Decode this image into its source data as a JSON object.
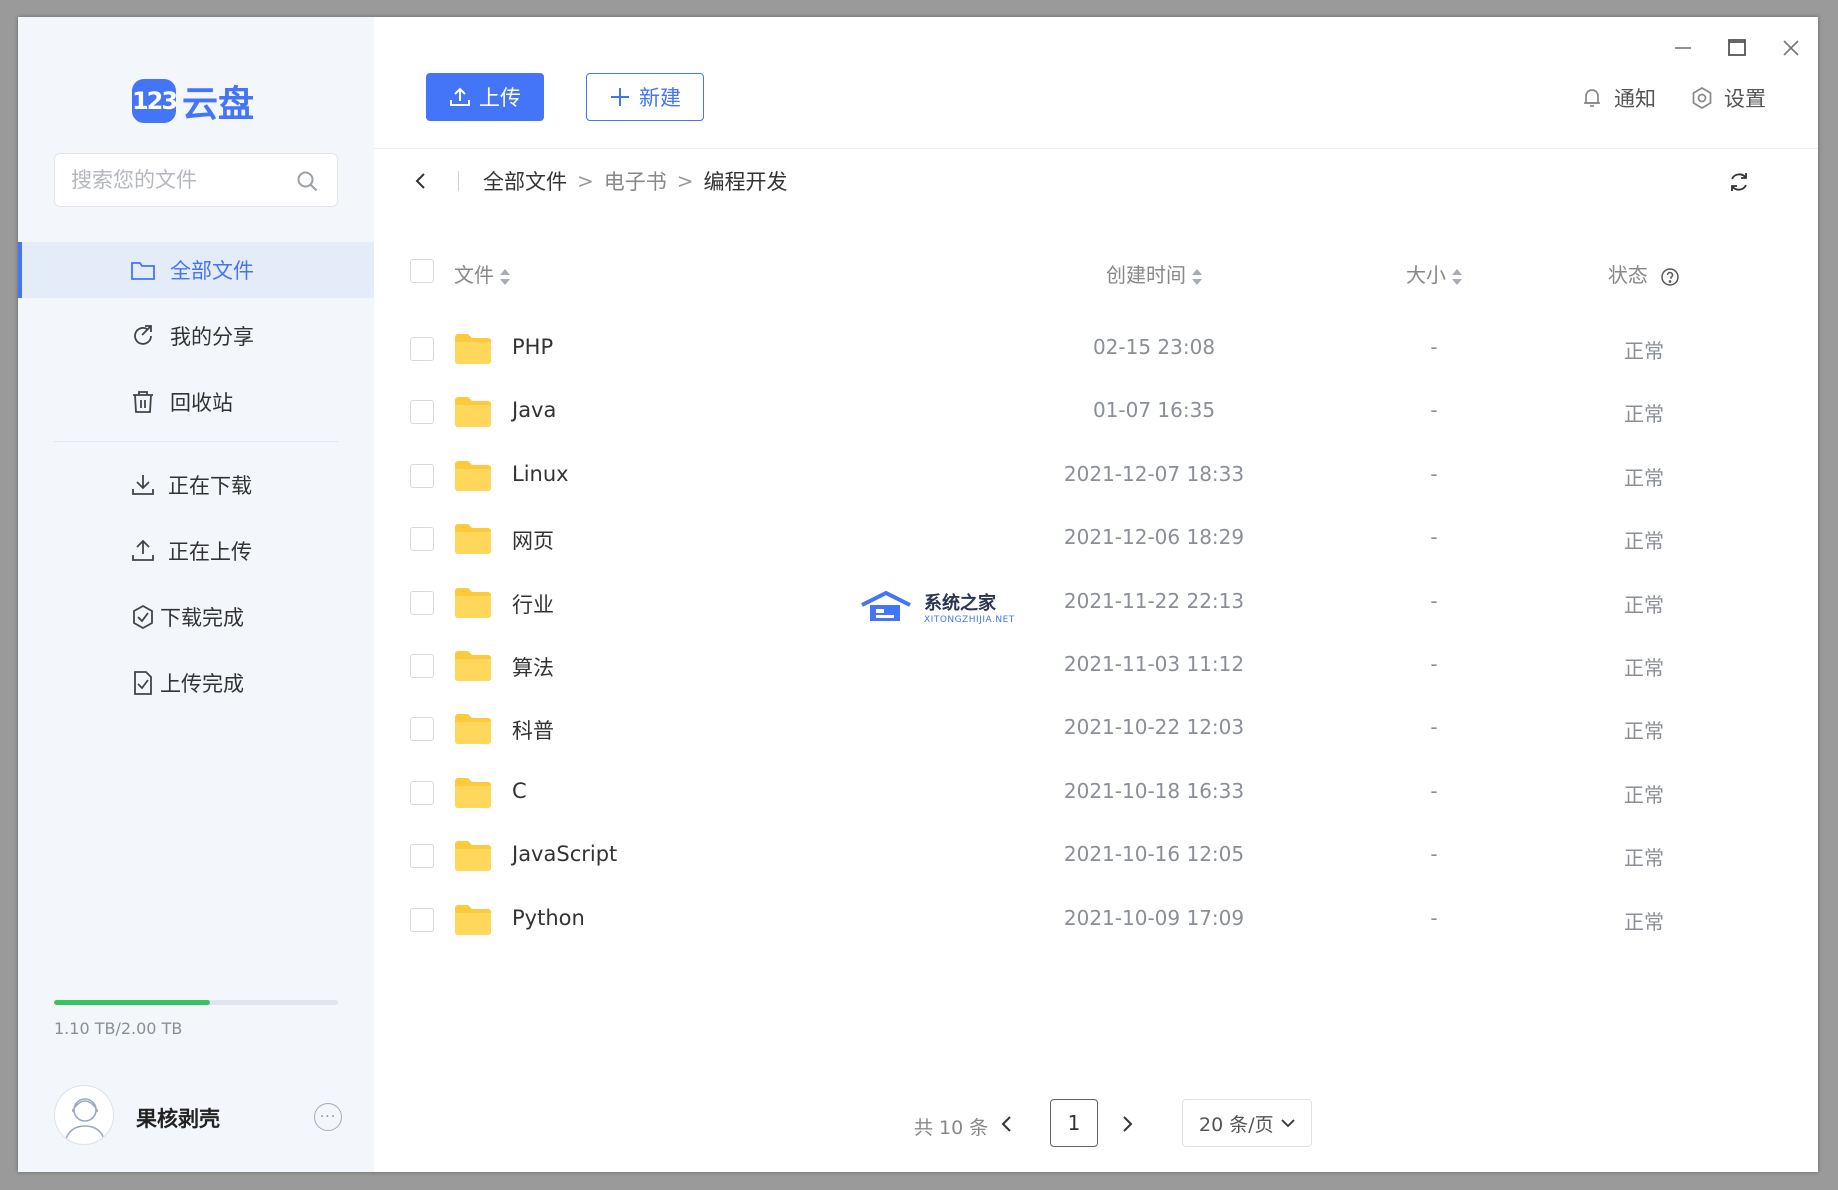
{
  "app": {
    "logo_badge": "123",
    "logo_text": "云盘"
  },
  "search": {
    "placeholder": "搜索您的文件"
  },
  "sidebar": {
    "items": [
      {
        "label": "全部文件",
        "icon": "folder-icon",
        "active": true
      },
      {
        "label": "我的分享",
        "icon": "share-icon"
      },
      {
        "label": "回收站",
        "icon": "trash-icon"
      },
      {
        "label": "正在下载",
        "icon": "download-icon"
      },
      {
        "label": "正在上传",
        "icon": "upload-icon"
      },
      {
        "label": "下载完成",
        "icon": "download-done-icon"
      },
      {
        "label": "上传完成",
        "icon": "upload-done-icon"
      }
    ],
    "storage": {
      "text": "1.10 TB/2.00 TB",
      "used_fraction": 0.55
    },
    "user": {
      "name": "果核剥壳"
    }
  },
  "toolbar": {
    "upload_label": "上传",
    "new_label": "新建",
    "notify_label": "通知",
    "settings_label": "设置"
  },
  "breadcrumb": {
    "items": [
      "全部文件",
      "电子书",
      "编程开发"
    ]
  },
  "table": {
    "headers": {
      "name": "文件",
      "time": "创建时间",
      "size": "大小",
      "status": "状态"
    },
    "rows": [
      {
        "name": "PHP",
        "time": "02-15 23:08",
        "size": "-",
        "status": "正常"
      },
      {
        "name": "Java",
        "time": "01-07 16:35",
        "size": "-",
        "status": "正常"
      },
      {
        "name": "Linux",
        "time": "2021-12-07 18:33",
        "size": "-",
        "status": "正常"
      },
      {
        "name": "网页",
        "time": "2021-12-06 18:29",
        "size": "-",
        "status": "正常"
      },
      {
        "name": "行业",
        "time": "2021-11-22 22:13",
        "size": "-",
        "status": "正常"
      },
      {
        "name": "算法",
        "time": "2021-11-03 11:12",
        "size": "-",
        "status": "正常"
      },
      {
        "name": "科普",
        "time": "2021-10-22 12:03",
        "size": "-",
        "status": "正常"
      },
      {
        "name": "C",
        "time": "2021-10-18 16:33",
        "size": "-",
        "status": "正常"
      },
      {
        "name": "JavaScript",
        "time": "2021-10-16 12:05",
        "size": "-",
        "status": "正常"
      },
      {
        "name": "Python",
        "time": "2021-10-09 17:09",
        "size": "-",
        "status": "正常"
      }
    ]
  },
  "pagination": {
    "total": "共 10 条",
    "current_page": "1",
    "page_size": "20 条/页"
  },
  "watermark": {
    "title": "系统之家",
    "subtitle": "XITONGZHIJIA.NET"
  },
  "colors": {
    "accent": "#4474f7",
    "sidebar_bg": "#f3f6fb",
    "folder": "#ffc93c",
    "storage_fill": "#37c45e"
  }
}
